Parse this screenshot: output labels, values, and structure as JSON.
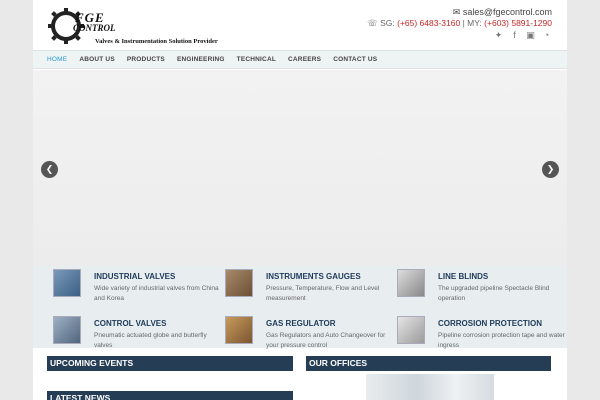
{
  "header": {
    "logo": {
      "fge": "FGE",
      "control": "CONTROL",
      "tagline": "Valves & Instrumentation Solution Provider"
    },
    "email": "sales@fgecontrol.com",
    "phone": {
      "sg_label": "SG:",
      "sg_number": "(+65) 6483-3160",
      "separator": "| MY:",
      "my_number": "(+603) 5891-1290"
    },
    "social": [
      {
        "icon": "twitter-icon",
        "glyph": "🐦"
      },
      {
        "icon": "facebook-icon",
        "glyph": "f"
      },
      {
        "icon": "youtube-icon",
        "glyph": "▶"
      },
      {
        "icon": "rss-icon",
        "glyph": "◉"
      }
    ]
  },
  "nav": {
    "items": [
      {
        "label": "HOME",
        "active": true
      },
      {
        "label": "ABOUT US"
      },
      {
        "label": "PRODUCTS"
      },
      {
        "label": "ENGINEERING"
      },
      {
        "label": "TECHNICAL"
      },
      {
        "label": "CAREERS"
      },
      {
        "label": "CONTACT US"
      }
    ]
  },
  "slider": {
    "prev": "❮",
    "next": "❯"
  },
  "products": [
    {
      "title": "INDUSTRIAL VALVES",
      "desc": "Wide variety of industrial valves from China and Korea"
    },
    {
      "title": "INSTRUMENTS GAUGES",
      "desc": "Pressure, Temperature, Flow and Level measurement"
    },
    {
      "title": "LINE BLINDS",
      "desc": "The upgraded pipeline Spectacle Blind operation"
    },
    {
      "title": "CONTROL VALVES",
      "desc": "Pneumatic actuated globe and butterfly valves"
    },
    {
      "title": "GAS REGULATOR",
      "desc": "Gas Regulators and Auto Changeover for your pressure control"
    },
    {
      "title": "CORROSION PROTECTION",
      "desc": "Pipeline corrosion protection tape and water ingress"
    }
  ],
  "sections": {
    "events": "UPCOMING EVENTS",
    "offices": "OUR OFFICES",
    "news": "LATEST NEWS"
  },
  "colors": {
    "accent": "#2a9ad6",
    "phone_red": "#c62828",
    "bar_navy": "#263e55"
  }
}
